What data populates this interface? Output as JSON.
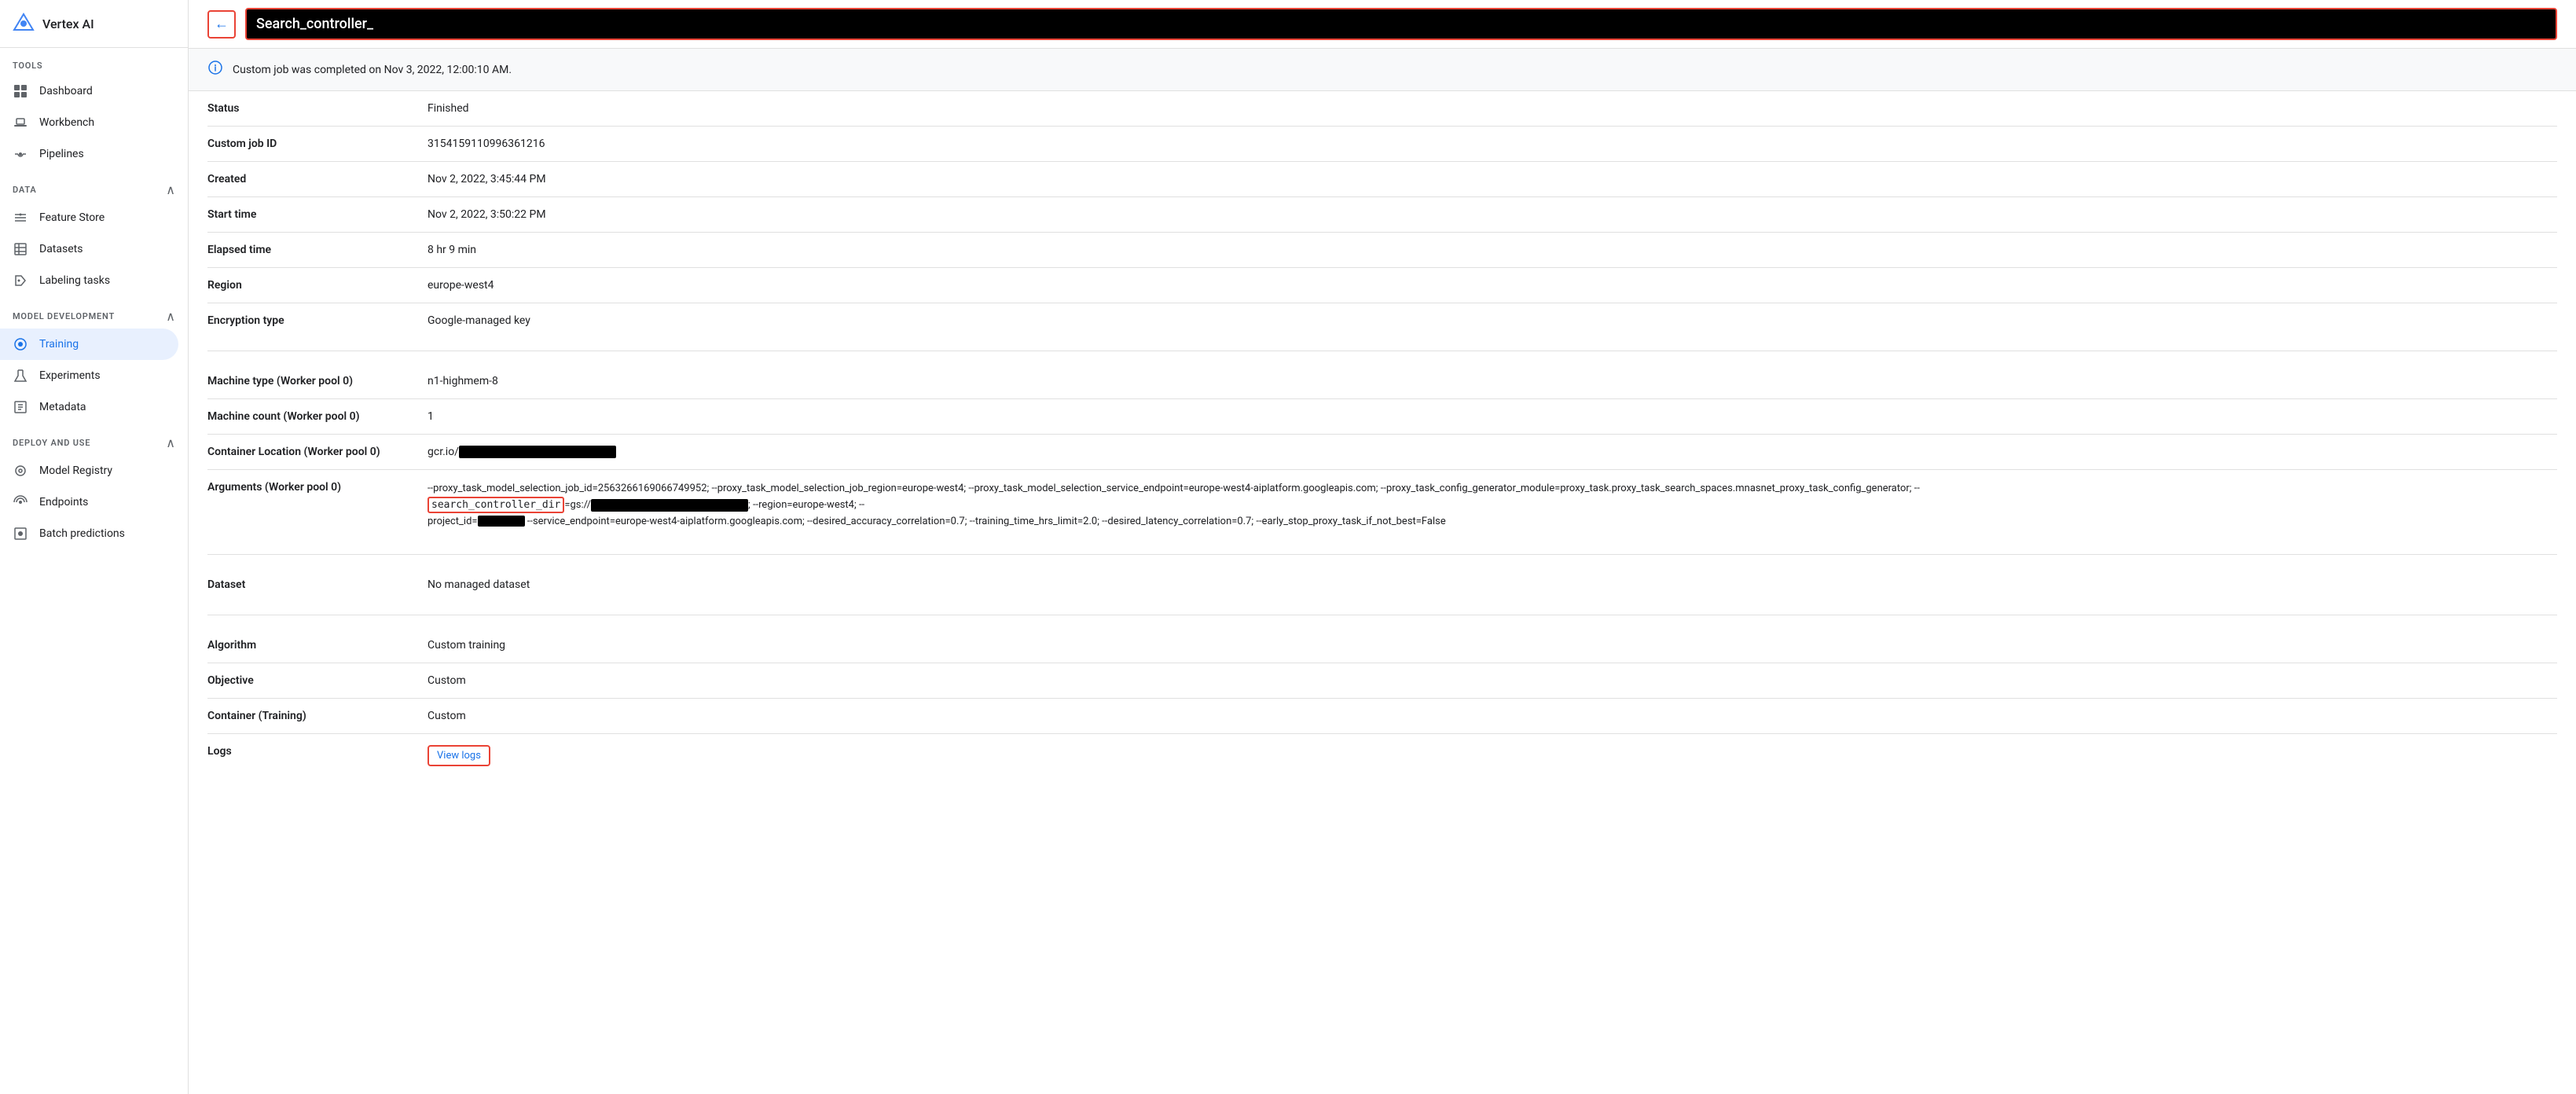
{
  "app": {
    "brand": "Vertex AI",
    "logo_label": "vertex-logo"
  },
  "sidebar": {
    "tools_label": "TOOLS",
    "data_label": "DATA",
    "model_dev_label": "MODEL DEVELOPMENT",
    "deploy_label": "DEPLOY AND USE",
    "items": {
      "dashboard": "Dashboard",
      "workbench": "Workbench",
      "pipelines": "Pipelines",
      "feature_store": "Feature Store",
      "datasets": "Datasets",
      "labeling_tasks": "Labeling tasks",
      "training": "Training",
      "experiments": "Experiments",
      "metadata": "Metadata",
      "model_registry": "Model Registry",
      "endpoints": "Endpoints",
      "batch_predictions": "Batch predictions"
    }
  },
  "header": {
    "title": "Search_controller_",
    "back_label": "←"
  },
  "info_banner": {
    "message": "Custom job was completed on Nov 3, 2022, 12:00:10 AM."
  },
  "details": {
    "status_label": "Status",
    "status_value": "Finished",
    "custom_job_id_label": "Custom job ID",
    "custom_job_id_value": "315415911099636121​6",
    "created_label": "Created",
    "created_value": "Nov 2, 2022, 3:45:44 PM",
    "start_time_label": "Start time",
    "start_time_value": "Nov 2, 2022, 3:50:22 PM",
    "elapsed_time_label": "Elapsed time",
    "elapsed_time_value": "8 hr 9 min",
    "region_label": "Region",
    "region_value": "europe-west4",
    "encryption_label": "Encryption type",
    "encryption_value": "Google-managed key",
    "machine_type_label": "Machine type (Worker pool 0)",
    "machine_type_value": "n1-highmem-8",
    "machine_count_label": "Machine count (Worker pool 0)",
    "machine_count_value": "1",
    "container_location_label": "Container Location (Worker pool 0)",
    "container_location_prefix": "gcr.io/",
    "arguments_label": "Arguments (Worker pool 0)",
    "arguments_line1": "--proxy_task_model_selection_job_id=2563266169066749952; --proxy_task_model_selection_job_region=europe-west4; --proxy_task_model_selection_service_endpoint=europe-west4-aiplatform.googleapis.com; --proxy_task_config_generator_module=proxy_task.proxy_task_search_spaces.mnasnet_proxy_task_config_generator; --",
    "arguments_highlight": "search_controller_dir",
    "arguments_line2_prefix": "=gs://",
    "arguments_line2_suffix": "; --region=europe-west4; --",
    "arguments_line3": "project_id=",
    "arguments_line3_suffix": " --service_endpoint=europe-west4-aiplatform.googleapis.com; --desired_accuracy_correlation=0.7; --training_time_hrs_limit=2.0; --desired_latency_correlation=0.7; --early_stop_proxy_task_if_not_best=False",
    "dataset_label": "Dataset",
    "dataset_value": "No managed dataset",
    "algorithm_label": "Algorithm",
    "algorithm_value": "Custom training",
    "objective_label": "Objective",
    "objective_value": "Custom",
    "container_training_label": "Container (Training)",
    "container_training_value": "Custom",
    "logs_label": "Logs",
    "logs_link_text": "View logs"
  }
}
